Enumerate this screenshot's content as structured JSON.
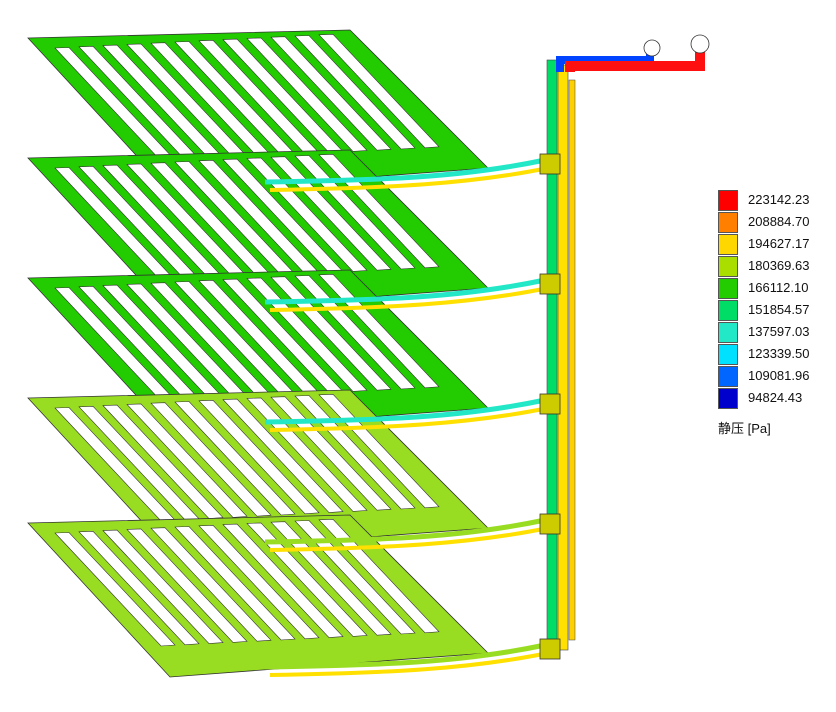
{
  "legend": {
    "title": "静压 [Pa]",
    "entries": [
      {
        "value": "223142.23",
        "color": "#ff0000"
      },
      {
        "value": "208884.70",
        "color": "#ff7f00"
      },
      {
        "value": "194627.17",
        "color": "#ffd700"
      },
      {
        "value": "180369.63",
        "color": "#aadd00"
      },
      {
        "value": "166112.10",
        "color": "#22cc00"
      },
      {
        "value": "151854.57",
        "color": "#00dd66"
      },
      {
        "value": "137597.03",
        "color": "#22e8c8"
      },
      {
        "value": "123339.50",
        "color": "#00e0ff"
      },
      {
        "value": "109081.96",
        "color": "#0066ff"
      },
      {
        "value": "94824.43",
        "color": "#0000cc"
      }
    ]
  },
  "plates": [
    {
      "color": "#22cc00"
    },
    {
      "color": "#22cc00"
    },
    {
      "color": "#22cc00"
    },
    {
      "color": "#99dd22"
    },
    {
      "color": "#99dd22"
    }
  ]
}
